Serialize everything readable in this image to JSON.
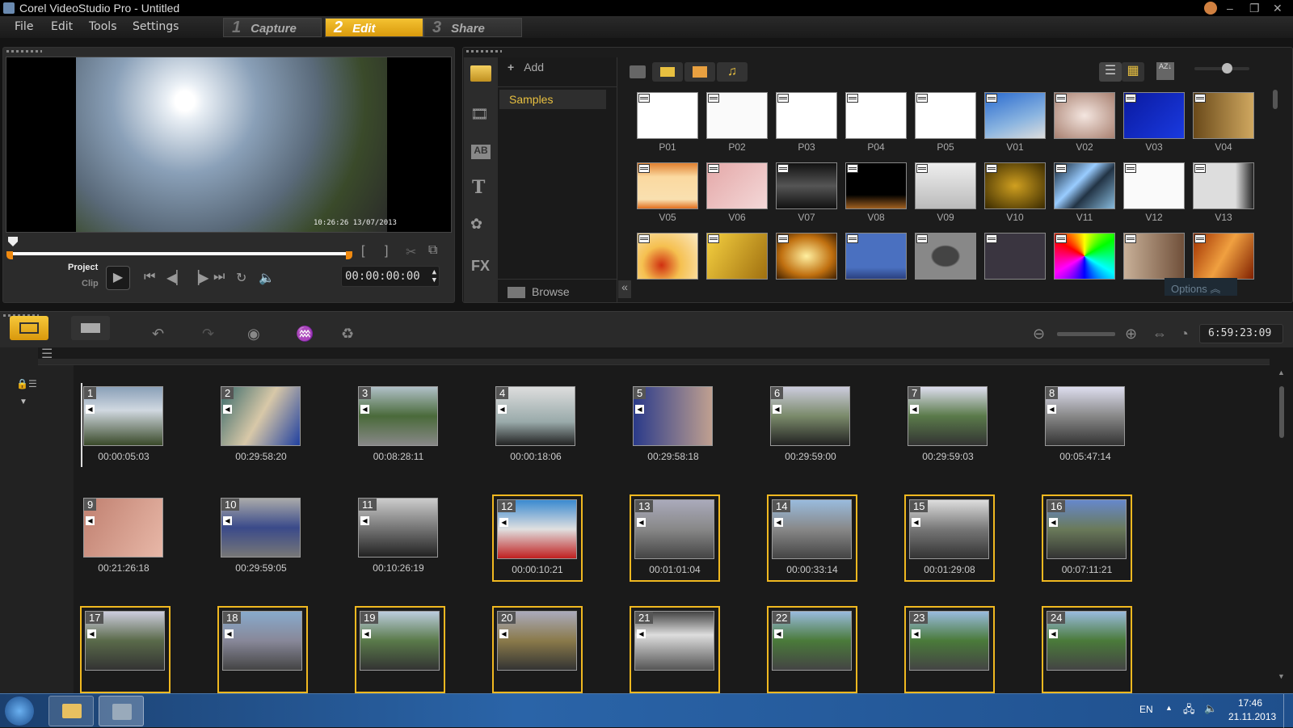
{
  "window": {
    "title": "Corel VideoStudio Pro - Untitled"
  },
  "menu": [
    "File",
    "Edit",
    "Tools",
    "Settings"
  ],
  "steps": [
    {
      "n": "1",
      "label": "Capture"
    },
    {
      "n": "2",
      "label": "Edit",
      "active": true
    },
    {
      "n": "3",
      "label": "Share"
    }
  ],
  "player": {
    "mode_project": "Project",
    "mode_clip": "Clip",
    "timecode": "00:00:00:00",
    "overlay": "10:26:26 13/07/2013"
  },
  "library": {
    "add_label": "Add",
    "folders": [
      "Samples"
    ],
    "browse_label": "Browse",
    "options_label": "Options",
    "items": [
      {
        "label": "P01",
        "bg": "#fff"
      },
      {
        "label": "P02",
        "bg": "#fafafa"
      },
      {
        "label": "P03",
        "bg": "#fff"
      },
      {
        "label": "P04",
        "bg": "#fff"
      },
      {
        "label": "P05",
        "bg": "#fff"
      },
      {
        "label": "V01",
        "bg": "linear-gradient(160deg,#2a6bd0,#8ab4e0 60%,#ddd)"
      },
      {
        "label": "V02",
        "bg": "radial-gradient(#f4e6e0,#a88070)"
      },
      {
        "label": "V03",
        "bg": "linear-gradient(135deg,#0a1aa0,#1a3ae0)"
      },
      {
        "label": "V04",
        "bg": "linear-gradient(90deg,#6a4a1a,#d0a860)"
      },
      {
        "label": "V05",
        "bg": "linear-gradient(#e08030,#fbd9a0 30%,#f9e0b0 80%,#e07020)"
      },
      {
        "label": "V06",
        "bg": "linear-gradient(135deg,#e4a8a8,#f4d8d8)"
      },
      {
        "label": "V07",
        "bg": "linear-gradient(#111,#555 50%,#111)"
      },
      {
        "label": "V08",
        "bg": "linear-gradient(#000 70%,#a06020)"
      },
      {
        "label": "V09",
        "bg": "linear-gradient(#eee,#bbb)"
      },
      {
        "label": "V10",
        "bg": "radial-gradient(#d0a020,#3a2a00)"
      },
      {
        "label": "V11",
        "bg": "linear-gradient(135deg,#123,#9cf 40%,#234 60%,#8bd)"
      },
      {
        "label": "V12",
        "bg": "#fafafa"
      },
      {
        "label": "V13",
        "bg": "linear-gradient(90deg,#ddd 70%,#222)"
      },
      {
        "label": "",
        "bg": "radial-gradient(circle at 40% 70%,#d03010,#f5c050 40%,#fbe8c0)"
      },
      {
        "label": "",
        "bg": "linear-gradient(120deg,#f5d040,#a07010)"
      },
      {
        "label": "",
        "bg": "radial-gradient(#fff0a0,#c07010 60%,#402000)"
      },
      {
        "label": "",
        "bg": "linear-gradient(#4a70c0 75%,#2a4080)"
      },
      {
        "label": "",
        "bg": "radial-gradient(#444 30%,#888 35%)"
      },
      {
        "label": "",
        "bg": "#3a3540"
      },
      {
        "label": "",
        "bg": "conic-gradient(#ff0,#0f0,#0ff,#00f,#f0f,#f00,#ff0)"
      },
      {
        "label": "",
        "bg": "linear-gradient(90deg,#c8b098,#70503a)"
      },
      {
        "label": "",
        "bg": "linear-gradient(120deg,#a03000,#f0a040,#802000)"
      }
    ]
  },
  "timeline": {
    "duration": "6:59:23:09",
    "clips": [
      {
        "n": "1",
        "t": "00:00:05:03",
        "sel": false,
        "bg": "linear-gradient(#8aa0b8,#d0d8e0 40%,#3a4a2a)"
      },
      {
        "n": "2",
        "t": "00:29:58:20",
        "sel": false,
        "bg": "linear-gradient(120deg,#3a6a6a,#d8c8a8 50%,#2040a0)"
      },
      {
        "n": "3",
        "t": "00:08:28:11",
        "sel": false,
        "bg": "linear-gradient(#b0c0c8,#4a6a3a 50%,#888)"
      },
      {
        "n": "4",
        "t": "00:00:18:06",
        "sel": false,
        "bg": "linear-gradient(#ddd,#9aa 60%,#222)"
      },
      {
        "n": "5",
        "t": "00:29:58:18",
        "sel": false,
        "bg": "linear-gradient(90deg,#2a3a8a,#c0a090)"
      },
      {
        "n": "6",
        "t": "00:29:59:00",
        "sel": false,
        "bg": "linear-gradient(#ccd,#7a8a6a 50%,#222)"
      },
      {
        "n": "7",
        "t": "00:29:59:03",
        "sel": false,
        "bg": "linear-gradient(#dde,#5a7a4a 50%,#333)"
      },
      {
        "n": "8",
        "t": "00:05:47:14",
        "sel": false,
        "bg": "linear-gradient(#dde,#888 50%,#333)"
      },
      {
        "n": "9",
        "t": "00:21:26:18",
        "sel": false,
        "bg": "linear-gradient(120deg,#c08070,#e8b8a8)"
      },
      {
        "n": "10",
        "t": "00:29:59:05",
        "sel": false,
        "bg": "linear-gradient(#aaa,#3a4a8a 50%,#777)"
      },
      {
        "n": "11",
        "t": "00:10:26:19",
        "sel": false,
        "bg": "linear-gradient(#ccc,#777 50%,#222)"
      },
      {
        "n": "12",
        "t": "00:00:10:21",
        "sel": true,
        "bg": "linear-gradient(#3a8ad0,#e0e0e0 50%,#c02020)"
      },
      {
        "n": "13",
        "t": "00:01:01:04",
        "sel": true,
        "bg": "linear-gradient(#aab,#888 50%,#444)"
      },
      {
        "n": "14",
        "t": "00:00:33:14",
        "sel": true,
        "bg": "linear-gradient(#9bd,#888 50%,#444)"
      },
      {
        "n": "15",
        "t": "00:01:29:08",
        "sel": true,
        "bg": "linear-gradient(#ddd,#777 50%,#333)"
      },
      {
        "n": "16",
        "t": "00:07:11:21",
        "sel": true,
        "bg": "linear-gradient(#68c,#6a7a5a 50%,#333)"
      },
      {
        "n": "17",
        "t": "",
        "sel": true,
        "bg": "linear-gradient(#ccd,#5a6a4a 50%,#333)"
      },
      {
        "n": "18",
        "t": "",
        "sel": true,
        "bg": "linear-gradient(#8ac,#889 50%,#444)"
      },
      {
        "n": "19",
        "t": "",
        "sel": true,
        "bg": "linear-gradient(#bcd,#5a7a4a 50%,#333)"
      },
      {
        "n": "20",
        "t": "",
        "sel": true,
        "bg": "linear-gradient(#aab,#8a7a4a 50%,#333)"
      },
      {
        "n": "21",
        "t": "",
        "sel": true,
        "bg": "linear-gradient(#444,#ddd 40%,#555)"
      },
      {
        "n": "22",
        "t": "",
        "sel": true,
        "bg": "linear-gradient(#9bd,#4a7a3a 50%,#444)"
      },
      {
        "n": "23",
        "t": "",
        "sel": true,
        "bg": "linear-gradient(#9bd,#4a7a3a 50%,#444)"
      },
      {
        "n": "24",
        "t": "",
        "sel": true,
        "bg": "linear-gradient(#9bd,#4a7a3a 50%,#444)"
      }
    ]
  },
  "taskbar": {
    "lang": "EN",
    "time": "17:46",
    "date": "21.11.2013"
  },
  "colors": {
    "accent": "#f0b820",
    "background": "#141414"
  }
}
